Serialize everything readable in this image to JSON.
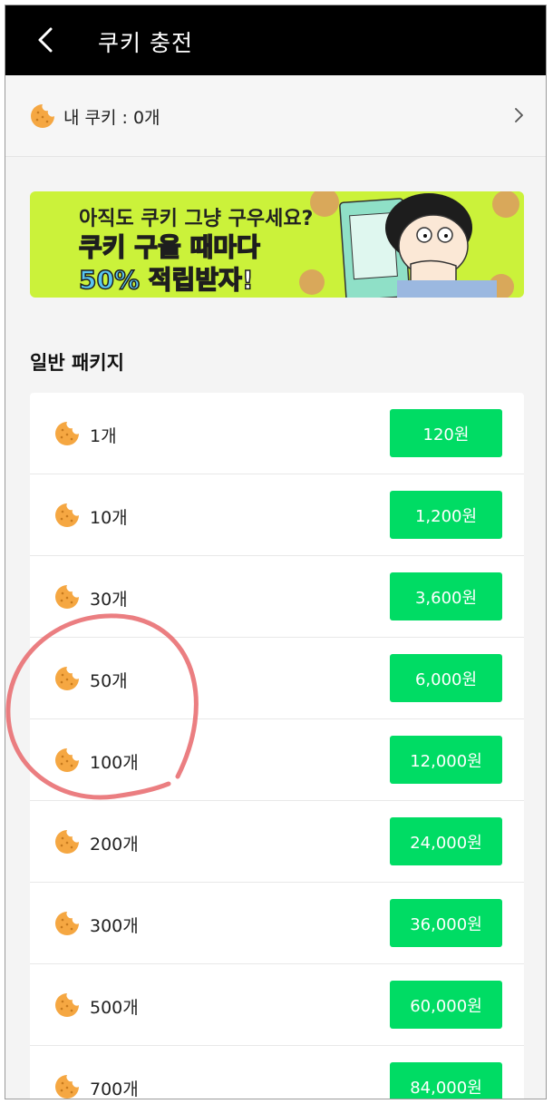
{
  "header": {
    "title": "쿠키 충전"
  },
  "my_cookie": {
    "label": "내 쿠키 : 0개"
  },
  "banner": {
    "line1": "아직도 쿠키 그냥 구우세요?",
    "line2": "쿠키 구울 때마다",
    "line3_a": "50% 적립",
    "line3_b": "받자!"
  },
  "section": {
    "title": "일반 패키지"
  },
  "packages": [
    {
      "qty": "1개",
      "price": "120원"
    },
    {
      "qty": "10개",
      "price": "1,200원"
    },
    {
      "qty": "30개",
      "price": "3,600원"
    },
    {
      "qty": "50개",
      "price": "6,000원"
    },
    {
      "qty": "100개",
      "price": "12,000원"
    },
    {
      "qty": "200개",
      "price": "24,000원"
    },
    {
      "qty": "300개",
      "price": "36,000원"
    },
    {
      "qty": "500개",
      "price": "60,000원"
    },
    {
      "qty": "700개",
      "price": "84,000원"
    }
  ],
  "colors": {
    "header_bg": "#000000",
    "buy_button": "#00dc64",
    "banner_bg": "#cbf23a",
    "cookie": "#f5a742",
    "annotation_circle": "#e8676b"
  },
  "icons": {
    "back": "chevron-left-icon",
    "cookie": "cookie-icon",
    "more": "chevron-right-icon"
  }
}
